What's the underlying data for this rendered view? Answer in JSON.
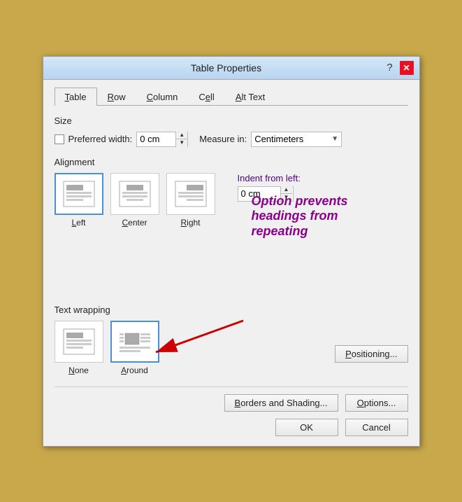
{
  "dialog": {
    "title": "Table Properties",
    "help_label": "?",
    "close_label": "✕"
  },
  "tabs": [
    {
      "label": "Table",
      "underline_index": 0,
      "active": true
    },
    {
      "label": "Row",
      "underline_index": 0
    },
    {
      "label": "Column",
      "underline_index": 0
    },
    {
      "label": "Cell",
      "underline_index": 0
    },
    {
      "label": "Alt Text",
      "underline_index": 4
    }
  ],
  "size": {
    "label": "Size",
    "preferred_width_label": "Preferred width:",
    "width_value": "0 cm",
    "measure_label": "Measure in:",
    "measure_value": "Centimeters"
  },
  "alignment": {
    "label": "Alignment",
    "options": [
      {
        "id": "left",
        "label": "Left",
        "selected": true
      },
      {
        "id": "center",
        "label": "Center",
        "selected": false
      },
      {
        "id": "right",
        "label": "Right",
        "selected": false
      }
    ],
    "indent_label": "Indent from left:",
    "indent_value": "0 cm"
  },
  "annotation": {
    "text": "Option prevents headings from repeating"
  },
  "text_wrapping": {
    "label": "Text wrapping",
    "options": [
      {
        "id": "none",
        "label": "None",
        "selected": false
      },
      {
        "id": "around",
        "label": "Around",
        "selected": true
      }
    ],
    "positioning_label": "Positioning..."
  },
  "bottom_buttons": {
    "borders_label": "Borders and Shading...",
    "options_label": "Options...",
    "ok_label": "OK",
    "cancel_label": "Cancel"
  }
}
